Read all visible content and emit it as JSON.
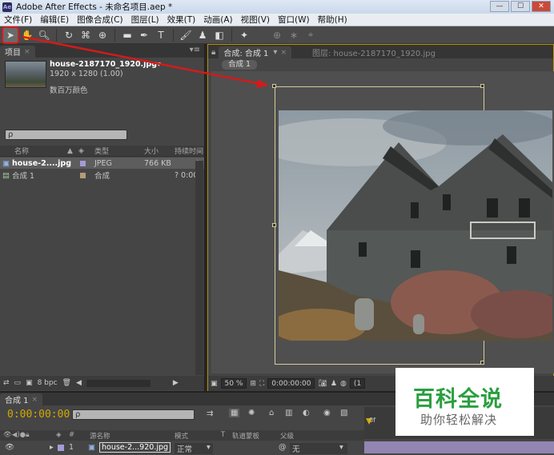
{
  "window": {
    "title": "Adobe After Effects - 未命名项目.aep *",
    "app_icon": "Ae"
  },
  "menu": [
    "文件(F)",
    "编辑(E)",
    "图像合成(C)",
    "图层(L)",
    "效果(T)",
    "动画(A)",
    "视图(V)",
    "窗口(W)",
    "帮助(H)"
  ],
  "tools": [
    "selection-tool",
    "hand-tool",
    "zoom-tool",
    "rotate-tool",
    "camera-tool",
    "pan-behind-tool",
    "rectangle-tool",
    "pen-tool",
    "type-tool",
    "brush-tool",
    "clone-stamp-tool",
    "eraser-tool",
    "puppet-tool"
  ],
  "project_panel": {
    "tab_label": "项目",
    "footage": {
      "name": "house-2187170_1920.jpg▾",
      "dims": "1920 x 1280 (1.00)",
      "color": "数百万颜色"
    },
    "search_placeholder": "ρ",
    "columns": [
      "名称",
      "类型",
      "大小",
      "持续时间"
    ],
    "items": [
      {
        "name": "house-2....jpg",
        "type": "JPEG",
        "size": "766 KB",
        "duration": "",
        "swatch": "#a59bd6"
      },
      {
        "name": "合成 1",
        "type": "合成",
        "size": "",
        "duration": "? 0:00",
        "swatch": "#b39b78"
      }
    ],
    "bpc": "8 bpc"
  },
  "comp_panel": {
    "tab_label": "合成: 合成 1",
    "layer_tab": "图层: house-2187170_1920.jpg",
    "breadcrumb": "合成 1",
    "zoom": "50 %",
    "timecode": "0:00:00:00",
    "resolution": "(1"
  },
  "timeline": {
    "tab_label": "合成 1",
    "timecode": "0:00:00:00",
    "columns": [
      "#",
      "源名称",
      "模式",
      "T",
      "轨道蒙板",
      "父级"
    ],
    "layer": {
      "index": "1",
      "name": "house-2...920.jpg",
      "mode": "正常",
      "parent": "无"
    },
    "ruler_start": "0f"
  },
  "watermark": {
    "title": "百科全说",
    "subtitle": "助你轻松解决"
  },
  "colors": {
    "accent": "#d2a800",
    "highlight": "#d21b1b",
    "watermark_green": "#2a9f3f"
  }
}
